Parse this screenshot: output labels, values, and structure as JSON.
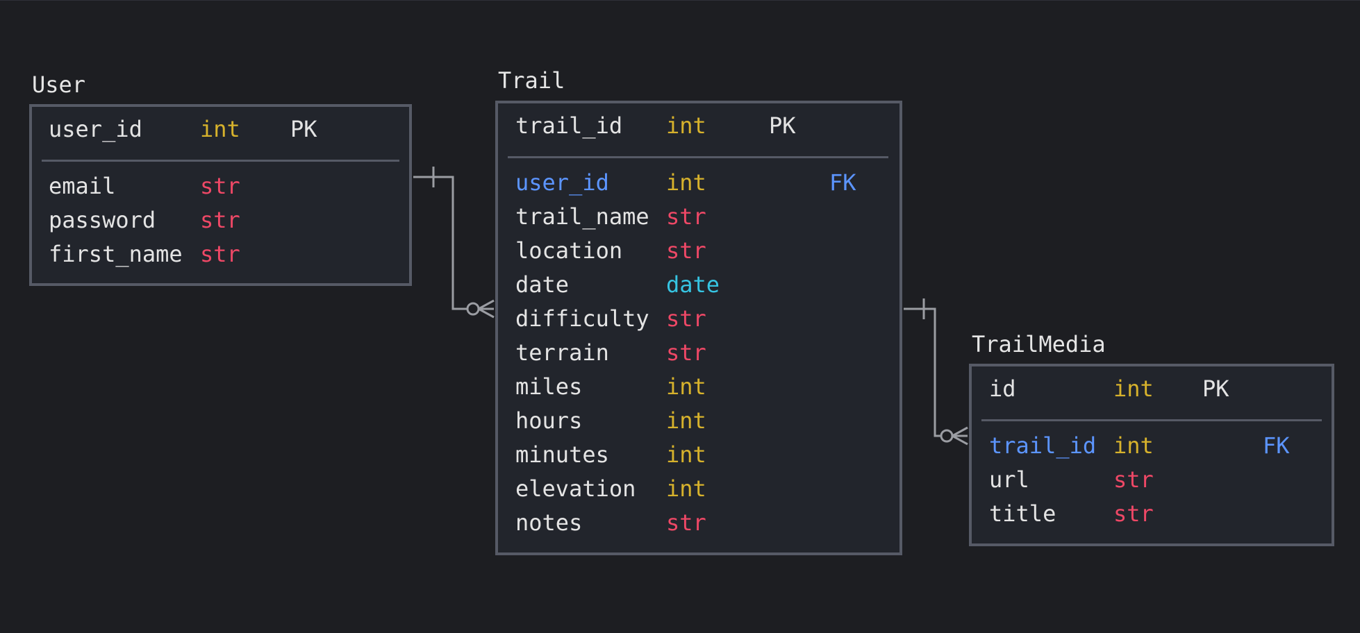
{
  "entities": {
    "user": {
      "title": "User",
      "pk": {
        "name": "user_id",
        "type": "int",
        "key": "PK"
      },
      "fields": [
        {
          "name": "email",
          "type": "str"
        },
        {
          "name": "password",
          "type": "str"
        },
        {
          "name": "first_name",
          "type": "str"
        }
      ]
    },
    "trail": {
      "title": "Trail",
      "pk": {
        "name": "trail_id",
        "type": "int",
        "key": "PK"
      },
      "fields": [
        {
          "name": "user_id",
          "type": "int",
          "key": "FK"
        },
        {
          "name": "trail_name",
          "type": "str"
        },
        {
          "name": "location",
          "type": "str"
        },
        {
          "name": "date",
          "type": "date"
        },
        {
          "name": "difficulty",
          "type": "str"
        },
        {
          "name": "terrain",
          "type": "str"
        },
        {
          "name": "miles",
          "type": "int"
        },
        {
          "name": "hours",
          "type": "int"
        },
        {
          "name": "minutes",
          "type": "int"
        },
        {
          "name": "elevation",
          "type": "int"
        },
        {
          "name": "notes",
          "type": "str"
        }
      ]
    },
    "trailmedia": {
      "title": "TrailMedia",
      "pk": {
        "name": "id",
        "type": "int",
        "key": "PK"
      },
      "fields": [
        {
          "name": "trail_id",
          "type": "int",
          "key": "FK"
        },
        {
          "name": "url",
          "type": "str"
        },
        {
          "name": "title",
          "type": "str"
        }
      ]
    }
  },
  "relationships": [
    {
      "from": "User",
      "to": "Trail",
      "from_cardinality": "one",
      "to_cardinality": "zero-or-many"
    },
    {
      "from": "Trail",
      "to": "TrailMedia",
      "from_cardinality": "one",
      "to_cardinality": "zero-or-many"
    }
  ],
  "colors": {
    "background": "#1d1e22",
    "box_fill": "#22252c",
    "border": "#565a66",
    "name": "#e4e4e4",
    "foreign_key": "#5c95ff",
    "int": "#d7b22c",
    "str": "#ee4866",
    "date": "#36c4e2",
    "connector": "#9b9da3"
  }
}
